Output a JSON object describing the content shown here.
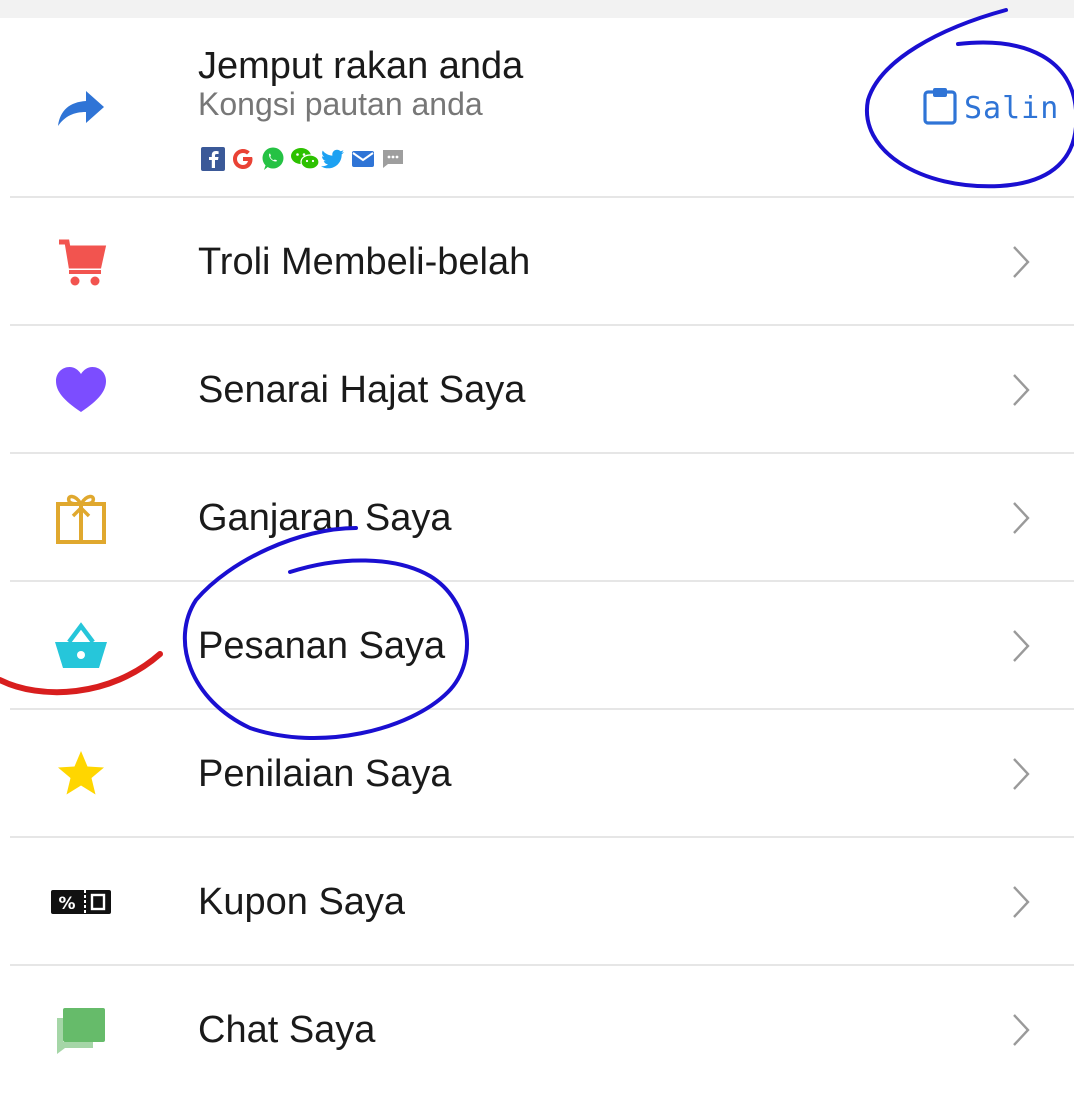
{
  "invite": {
    "title": "Jemput rakan anda",
    "subtitle": "Kongsi pautan anda",
    "copy_label": "Salin",
    "share_icons": [
      "facebook-icon",
      "google-icon",
      "whatsapp-icon",
      "wechat-icon",
      "twitter-icon",
      "email-icon",
      "sms-icon"
    ]
  },
  "menu": {
    "items": [
      {
        "label": "Troli Membeli-belah",
        "icon": "shopping-cart-icon",
        "color": "#f2544f"
      },
      {
        "label": "Senarai Hajat Saya",
        "icon": "heart-icon",
        "color": "#7c4dff"
      },
      {
        "label": "Ganjaran Saya",
        "icon": "gift-icon",
        "color": "#e0a82e"
      },
      {
        "label": "Pesanan Saya",
        "icon": "shopping-basket-icon",
        "color": "#26c6da"
      },
      {
        "label": "Penilaian Saya",
        "icon": "star-icon",
        "color": "#ffd600"
      },
      {
        "label": "Kupon Saya",
        "icon": "coupon-icon",
        "color": "#111111"
      },
      {
        "label": "Chat Saya",
        "icon": "chat-icon",
        "color": "#66bb6a"
      }
    ]
  },
  "colors": {
    "accent": "#2f74d6",
    "annotation_blue": "#1a0fd1",
    "annotation_red": "#d81e1e",
    "text": "#1a1a1a",
    "secondary_text": "#777777"
  }
}
